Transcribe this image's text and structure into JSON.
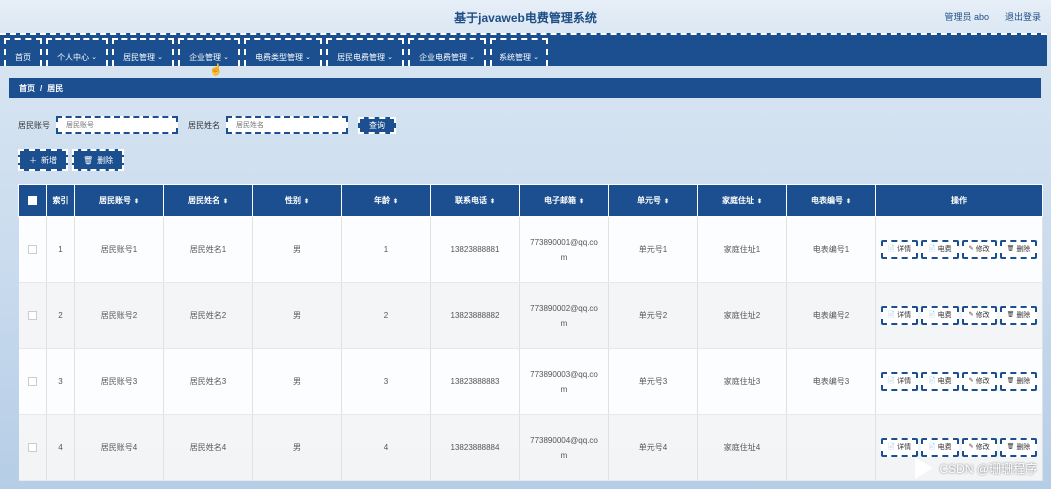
{
  "header": {
    "title": "基于javaweb电费管理系统",
    "admin_label": "管理员 abo",
    "logout_label": "退出登录"
  },
  "nav": {
    "items": [
      {
        "label": "首页",
        "dropdown": false
      },
      {
        "label": "个人中心",
        "dropdown": true
      },
      {
        "label": "居民管理",
        "dropdown": true
      },
      {
        "label": "企业管理",
        "dropdown": true
      },
      {
        "label": "电费类型管理",
        "dropdown": true
      },
      {
        "label": "居民电费管理",
        "dropdown": true
      },
      {
        "label": "企业电费管理",
        "dropdown": true
      },
      {
        "label": "系统管理",
        "dropdown": true
      }
    ]
  },
  "breadcrumb": {
    "home": "首页",
    "sep": "/",
    "current": "居民"
  },
  "search": {
    "account_label": "居民账号",
    "account_placeholder": "居民账号",
    "name_label": "居民姓名",
    "name_placeholder": "居民姓名",
    "query_label": "查询"
  },
  "actions": {
    "add_label": "新增",
    "delete_label": "删除"
  },
  "table": {
    "headers": [
      "索引",
      "居民账号",
      "居民姓名",
      "性别",
      "年龄",
      "联系电话",
      "电子邮箱",
      "单元号",
      "家庭住址",
      "电表编号",
      "操作"
    ],
    "rows": [
      {
        "index": "1",
        "account": "居民账号1",
        "name": "居民姓名1",
        "gender": "男",
        "age": "1",
        "phone": "13823888881",
        "email_a": "773890001@qq.co",
        "email_b": "m",
        "unit": "单元号1",
        "address": "家庭住址1",
        "meter": "电表编号1"
      },
      {
        "index": "2",
        "account": "居民账号2",
        "name": "居民姓名2",
        "gender": "男",
        "age": "2",
        "phone": "13823888882",
        "email_a": "773890002@qq.co",
        "email_b": "m",
        "unit": "单元号2",
        "address": "家庭住址2",
        "meter": "电表编号2"
      },
      {
        "index": "3",
        "account": "居民账号3",
        "name": "居民姓名3",
        "gender": "男",
        "age": "3",
        "phone": "13823888883",
        "email_a": "773890003@qq.co",
        "email_b": "m",
        "unit": "单元号3",
        "address": "家庭住址3",
        "meter": "电表编号3"
      },
      {
        "index": "4",
        "account": "居民账号4",
        "name": "居民姓名4",
        "gender": "男",
        "age": "4",
        "phone": "13823888884",
        "email_a": "773890004@qq.co",
        "email_b": "m",
        "unit": "单元号4",
        "address": "家庭住址4",
        "meter": ""
      }
    ],
    "op_labels": {
      "detail": "详情",
      "bill": "电费",
      "edit": "修改",
      "delete": "删除"
    }
  },
  "watermark": "CSDN @珊珊程序",
  "colors": {
    "primary": "#1b4f8f",
    "background": "#dbe7f3"
  },
  "icons": [
    "cursor-icon",
    "plus-icon",
    "trash-icon",
    "sort-icon",
    "document-icon",
    "pencil-icon",
    "play-icon"
  ]
}
